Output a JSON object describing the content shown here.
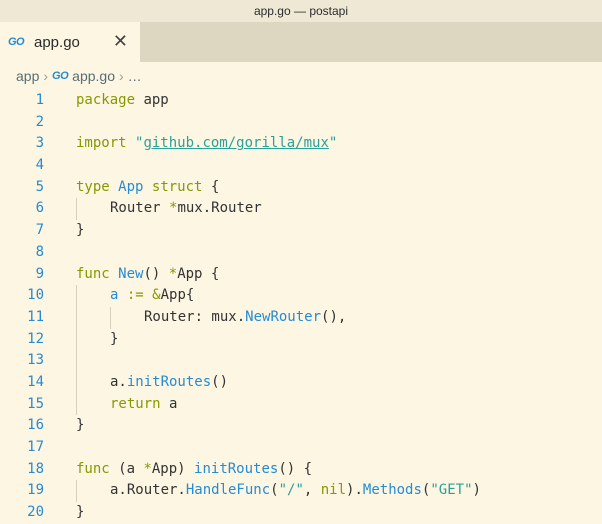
{
  "window": {
    "title": "app.go — postapi"
  },
  "tab": {
    "icon": "go-file-icon",
    "icon_text": "GO",
    "label": "app.go",
    "close": "✕"
  },
  "breadcrumb": {
    "folder": "app",
    "file": "app.go",
    "trail": "…"
  },
  "code": {
    "l1": {
      "n": "1",
      "a": "package",
      "b": " app"
    },
    "l2": {
      "n": "2"
    },
    "l3": {
      "n": "3",
      "a": "import",
      "b": " ",
      "c": "\"",
      "d": "github.com/gorilla/mux",
      "e": "\""
    },
    "l4": {
      "n": "4"
    },
    "l5": {
      "n": "5",
      "a": "type",
      "b": " ",
      "c": "App",
      "d": " ",
      "e": "struct",
      "f": " {"
    },
    "l6": {
      "n": "6",
      "a": "Router ",
      "b": "*",
      "c": "mux.Router"
    },
    "l7": {
      "n": "7",
      "a": "}"
    },
    "l8": {
      "n": "8"
    },
    "l9": {
      "n": "9",
      "a": "func",
      "b": " ",
      "c": "New",
      "d": "() ",
      "e": "*",
      "f": "App {"
    },
    "l10": {
      "n": "10",
      "a": "a",
      "b": " := ",
      "c": "&",
      "d": "App{"
    },
    "l11": {
      "n": "11",
      "a": "Router: mux.",
      "b": "NewRouter",
      "c": "(),"
    },
    "l12": {
      "n": "12",
      "a": "}"
    },
    "l13": {
      "n": "13"
    },
    "l14": {
      "n": "14",
      "a": "a.",
      "b": "initRoutes",
      "c": "()"
    },
    "l15": {
      "n": "15",
      "a": "return",
      "b": " a"
    },
    "l16": {
      "n": "16",
      "a": "}"
    },
    "l17": {
      "n": "17"
    },
    "l18": {
      "n": "18",
      "a": "func",
      "b": " (a ",
      "c": "*",
      "d": "App) ",
      "e": "initRoutes",
      "f": "() {"
    },
    "l19": {
      "n": "19",
      "a": "a.Router.",
      "b": "HandleFunc",
      "c": "(",
      "d": "\"/\"",
      "e": ", ",
      "f": "nil",
      "g": ").",
      "h": "Methods",
      "i": "(",
      "j": "\"GET\"",
      "k": ")"
    },
    "l20": {
      "n": "20",
      "a": "}"
    }
  },
  "colors": {
    "keyword": "#859900",
    "function": "#268bd2",
    "string": "#2aa198",
    "line_number": "#268bd2",
    "background": "#fdf6e3"
  }
}
